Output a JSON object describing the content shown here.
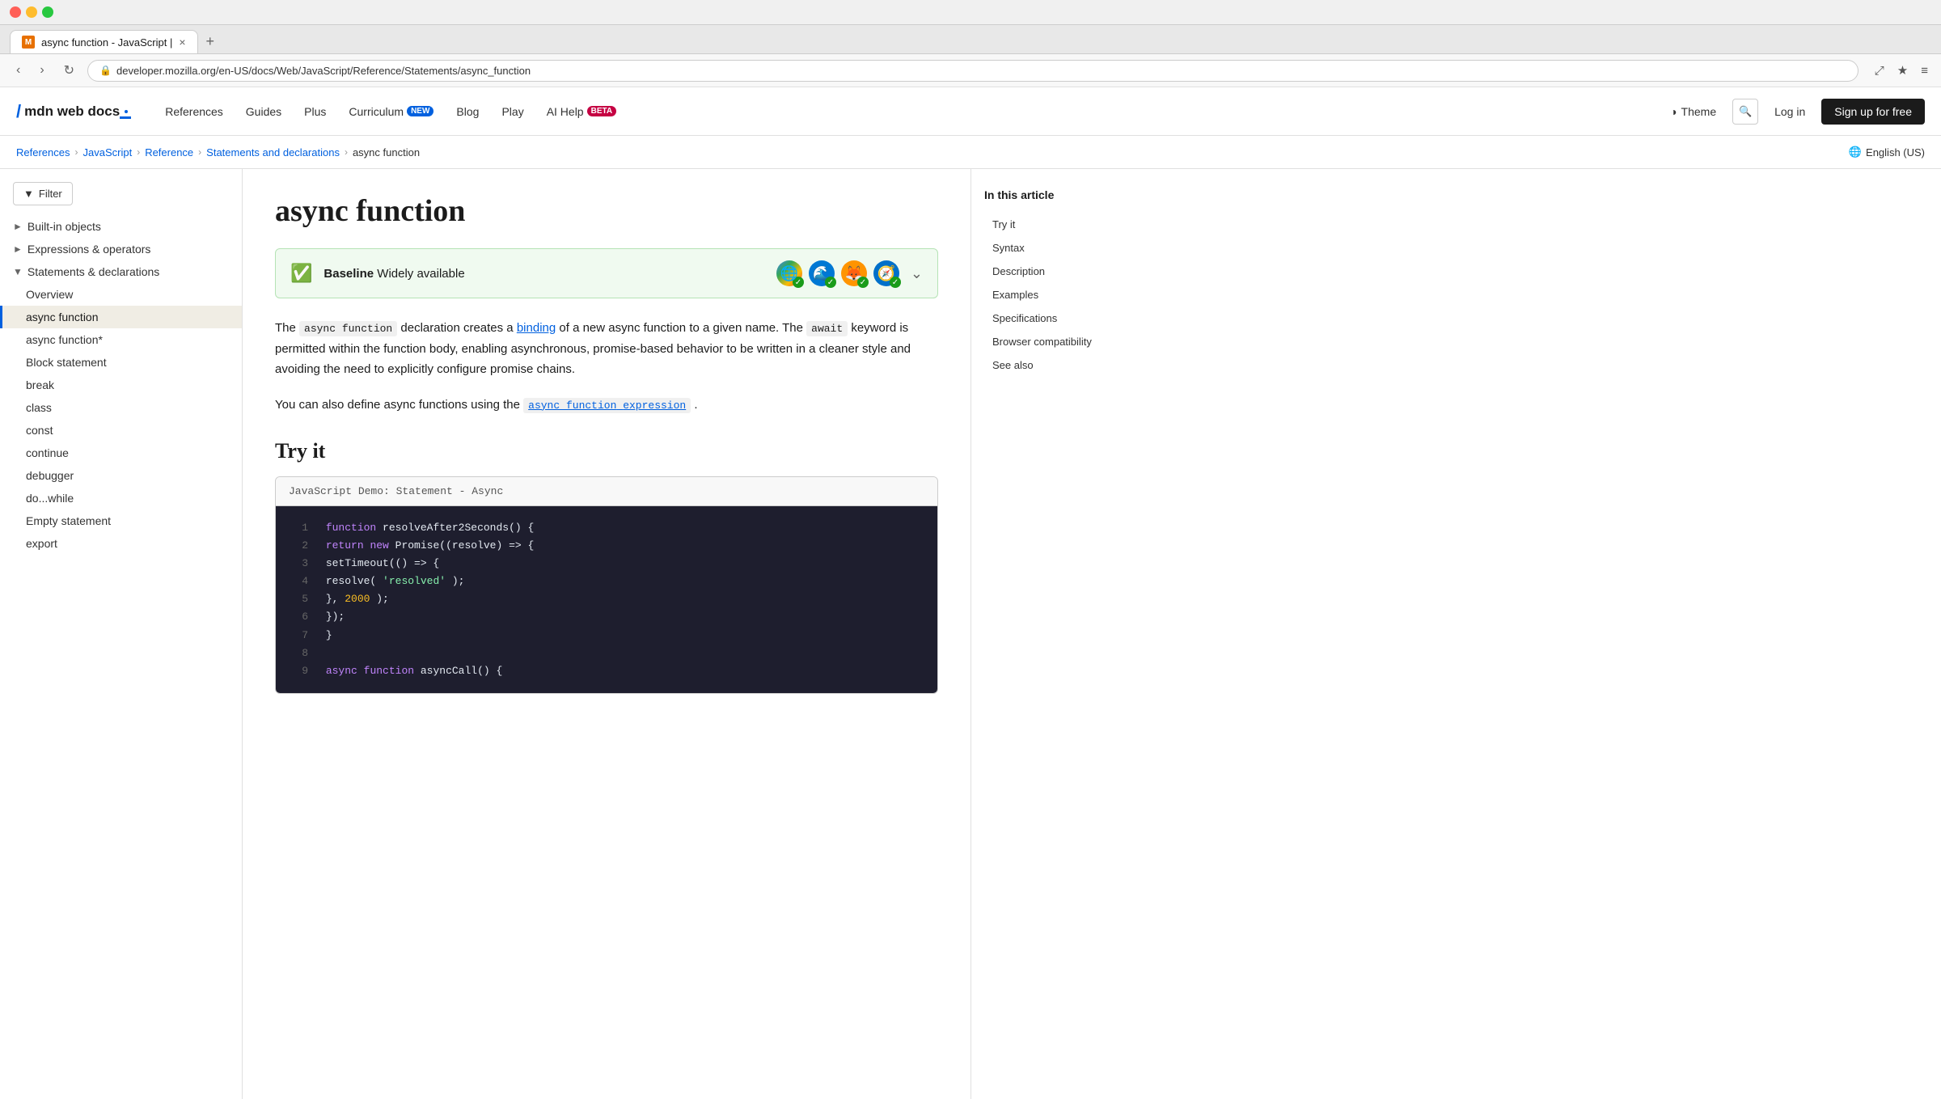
{
  "browser": {
    "tab_favicon": "M",
    "tab_title": "async function - JavaScript |",
    "tab_close": "×",
    "tab_new": "+",
    "nav_back": "‹",
    "nav_forward": "›",
    "nav_refresh": "↻",
    "address_url": "developer.mozilla.org/en-US/docs/Web/JavaScript/Reference/Statements/async_function",
    "nav_icons": [
      "⤢",
      "★",
      "⬛",
      "♦",
      "👤",
      "≡"
    ]
  },
  "header": {
    "logo_slash": "/",
    "logo_text": "mdn web docs",
    "nav_items": [
      {
        "label": "References",
        "badge": null
      },
      {
        "label": "Guides",
        "badge": null
      },
      {
        "label": "Plus",
        "badge": null
      },
      {
        "label": "Curriculum",
        "badge": "NEW"
      },
      {
        "label": "Blog",
        "badge": null
      },
      {
        "label": "Play",
        "badge": null
      },
      {
        "label": "AI Help",
        "badge": "BETA"
      }
    ],
    "theme_label": "Theme",
    "login_label": "Log in",
    "signup_label": "Sign up for free"
  },
  "breadcrumb": {
    "items": [
      "References",
      "JavaScript",
      "Reference",
      "Statements and declarations",
      "async function"
    ],
    "lang": "English (US)"
  },
  "sidebar": {
    "filter_label": "Filter",
    "sections": [
      {
        "label": "Built-in objects",
        "collapsed": true,
        "items": []
      },
      {
        "label": "Expressions & operators",
        "collapsed": true,
        "items": []
      },
      {
        "label": "Statements & declarations",
        "collapsed": false,
        "items": [
          {
            "label": "Overview",
            "active": false
          },
          {
            "label": "async function",
            "active": true
          },
          {
            "label": "async function*",
            "active": false
          },
          {
            "label": "Block statement",
            "active": false
          },
          {
            "label": "break",
            "active": false
          },
          {
            "label": "class",
            "active": false
          },
          {
            "label": "const",
            "active": false
          },
          {
            "label": "continue",
            "active": false
          },
          {
            "label": "debugger",
            "active": false
          },
          {
            "label": "do...while",
            "active": false
          },
          {
            "label": "Empty statement",
            "active": false
          },
          {
            "label": "export",
            "active": false
          }
        ]
      }
    ]
  },
  "article": {
    "title": "async function",
    "baseline_label": "Baseline",
    "baseline_text": "Widely available",
    "browsers": [
      {
        "icon": "🔵",
        "name": "Chrome"
      },
      {
        "icon": "🔵",
        "name": "Edge"
      },
      {
        "icon": "🦊",
        "name": "Firefox"
      },
      {
        "icon": "🔵",
        "name": "Safari"
      }
    ],
    "intro1_pre": "The ",
    "intro1_code": "async function",
    "intro1_mid": " declaration creates a ",
    "intro1_link": "binding",
    "intro1_post": " of a new async function to a given name. The",
    "intro1_code2": "await",
    "intro1_rest": "keyword is permitted within the function body, enabling asynchronous, promise-based behavior to be written in a cleaner style and avoiding the need to explicitly configure promise chains.",
    "intro2_pre": "You can also define async functions using the ",
    "intro2_link_code": "async function",
    "intro2_link_text2": "expression",
    "intro2_post": ".",
    "try_it_heading": "Try it",
    "code_demo_label": "JavaScript Demo: Statement - Async",
    "code_lines": [
      {
        "num": 1,
        "tokens": [
          {
            "type": "kw-function",
            "text": "function"
          },
          {
            "type": "code-white",
            "text": " resolveAfter2Seconds() {"
          }
        ]
      },
      {
        "num": 2,
        "tokens": [
          {
            "type": "kw-return",
            "text": "  return"
          },
          {
            "type": "kw-new",
            "text": " new"
          },
          {
            "type": "code-white",
            "text": " Promise((resolve) => {"
          }
        ]
      },
      {
        "num": 3,
        "tokens": [
          {
            "type": "code-white",
            "text": "    setTimeout(() => {"
          }
        ]
      },
      {
        "num": 4,
        "tokens": [
          {
            "type": "code-white",
            "text": "      resolve("
          },
          {
            "type": "str-val",
            "text": "'resolved'"
          },
          {
            "type": "code-white",
            "text": ");"
          }
        ]
      },
      {
        "num": 5,
        "tokens": [
          {
            "type": "code-white",
            "text": "    }, "
          },
          {
            "type": "num-val",
            "text": "2000"
          },
          {
            "type": "code-white",
            "text": ");"
          }
        ]
      },
      {
        "num": 6,
        "tokens": [
          {
            "type": "code-white",
            "text": "  });"
          }
        ]
      },
      {
        "num": 7,
        "tokens": [
          {
            "type": "code-white",
            "text": "}"
          }
        ]
      },
      {
        "num": 8,
        "tokens": [
          {
            "type": "code-white",
            "text": ""
          }
        ]
      },
      {
        "num": 9,
        "tokens": [
          {
            "type": "kw-async",
            "text": "async"
          },
          {
            "type": "code-white",
            "text": " "
          },
          {
            "type": "kw-function",
            "text": "function"
          },
          {
            "type": "code-white",
            "text": " asyncCall() {"
          }
        ]
      }
    ]
  },
  "toc": {
    "title": "In this article",
    "items": [
      "Try it",
      "Syntax",
      "Description",
      "Examples",
      "Specifications",
      "Browser compatibility",
      "See also"
    ]
  }
}
